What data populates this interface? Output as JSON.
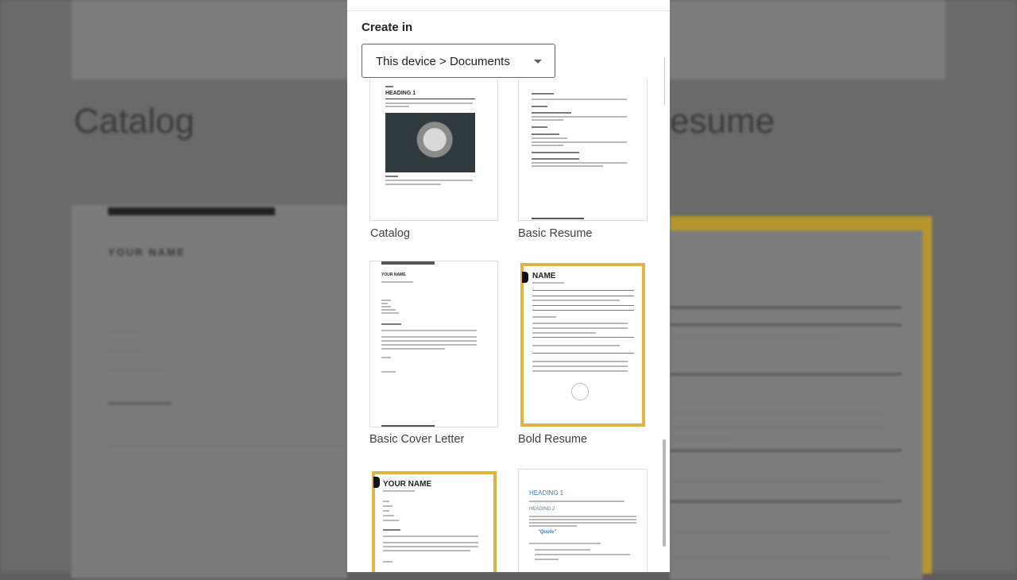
{
  "background": {
    "left_word": "Catalog",
    "right_word": "esume",
    "doc_name": "YOUR NAME"
  },
  "dialog": {
    "create_in_label": "Create in",
    "location_value": "This device > Documents"
  },
  "templates": [
    {
      "label": "Catalog",
      "thumb_heading": "HEADING 1"
    },
    {
      "label": "Basic Resume"
    },
    {
      "label": "Basic Cover Letter",
      "thumb_heading": "YOUR NAME"
    },
    {
      "label": "Bold Resume",
      "thumb_heading": "NAME"
    },
    {
      "label": "",
      "thumb_heading": "YOUR NAME"
    },
    {
      "label": "",
      "thumb_heading": "HEADING 1",
      "thumb_sub": "HEADING 2",
      "thumb_quote": "\"Quote\""
    }
  ],
  "colors": {
    "accent_gold": "#e0b443",
    "heading_blue": "#3a7fb8"
  }
}
